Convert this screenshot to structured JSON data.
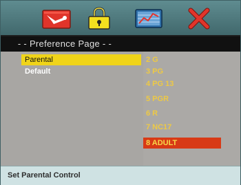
{
  "toolbar": {
    "icons": [
      "system-setup-icon",
      "parental-lock-icon",
      "preference-page-icon",
      "exit-icon"
    ]
  },
  "page": {
    "title": "- -  Preference Page  - -"
  },
  "menu": {
    "items": [
      {
        "label": "Parental",
        "selected": true
      },
      {
        "label": "Default",
        "selected": false
      }
    ]
  },
  "ratings": {
    "options": [
      "2 G",
      "3 PG",
      "4 PG 13",
      "5 PGR",
      "6 R",
      "7 NC17",
      "8 ADULT"
    ],
    "selected": "8 ADULT"
  },
  "status": {
    "text": "Set Parental Control"
  },
  "colors": {
    "menu_highlight": "#f0d419",
    "option_highlight": "#d83a16",
    "option_text": "#eec944",
    "header": "#4f7a7e"
  }
}
